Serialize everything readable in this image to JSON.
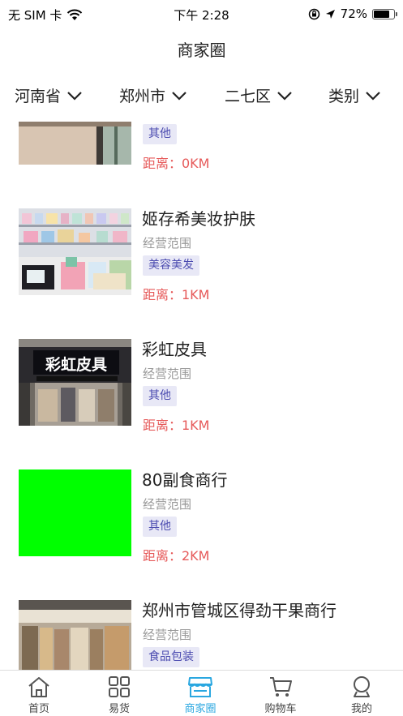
{
  "status": {
    "carrier": "无 SIM 卡",
    "time": "下午 2:28",
    "battery": "72%",
    "battery_level": 0.72
  },
  "header": {
    "title": "商家圈"
  },
  "filters": [
    {
      "label": "河南省"
    },
    {
      "label": "郑州市"
    },
    {
      "label": "二七区"
    },
    {
      "label": "类别"
    }
  ],
  "shops": [
    {
      "name": "",
      "scope": "",
      "tag": "其他",
      "distance": "距离：0KM"
    },
    {
      "name": "姬存希美妆护肤",
      "scope": "经营范围",
      "tag": "美容美发",
      "distance": "距离：1KM"
    },
    {
      "name": "彩虹皮具",
      "scope": "经营范围",
      "tag": "其他",
      "distance": "距离：1KM",
      "sign_text": "彩虹皮具"
    },
    {
      "name": "80副食商行",
      "scope": "经营范围",
      "tag": "其他",
      "distance": "距离：2KM"
    },
    {
      "name": "郑州市管城区得劲干果商行",
      "scope": "经营范围",
      "tag": "食品包装",
      "distance": ""
    }
  ],
  "tabbar": [
    {
      "label": "首页",
      "icon": "home-icon"
    },
    {
      "label": "易货",
      "icon": "grid-icon"
    },
    {
      "label": "商家圈",
      "icon": "store-icon",
      "active": true
    },
    {
      "label": "购物车",
      "icon": "cart-icon"
    },
    {
      "label": "我的",
      "icon": "user-icon"
    }
  ],
  "colors": {
    "accent": "#2aa7e0",
    "distance": "#e65a5a",
    "tag_bg": "#e8e8f6",
    "tag_text": "#4b4bb0",
    "placeholder_green": "#00ff00"
  }
}
